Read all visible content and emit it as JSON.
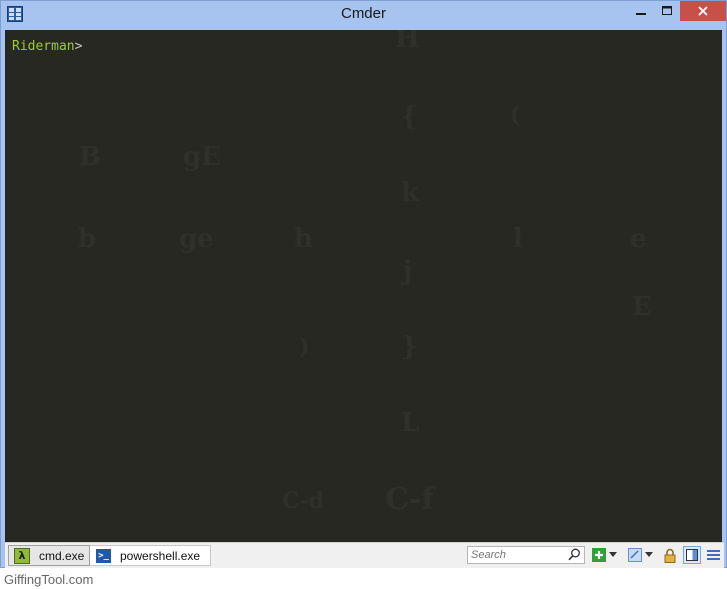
{
  "window": {
    "title": "Cmder"
  },
  "console": {
    "prompt_user": "Riderman",
    "prompt_symbol": ">",
    "background_color": "#272822",
    "prompt_color": "#9acd32"
  },
  "tabs": [
    {
      "label": "cmd.exe",
      "icon": "lambda-icon"
    },
    {
      "label": "powershell.exe",
      "icon": "powershell-icon"
    }
  ],
  "search": {
    "placeholder": "Search"
  },
  "footer": {
    "text": "GiffingTool.com"
  },
  "background_watermark": {
    "glyphs": [
      "H",
      "{",
      "(",
      "B",
      "gE",
      "k",
      "b",
      "ge",
      "h",
      "l",
      "e",
      "j",
      "E",
      ")",
      "}",
      "L",
      "C-d",
      "C-f"
    ]
  }
}
